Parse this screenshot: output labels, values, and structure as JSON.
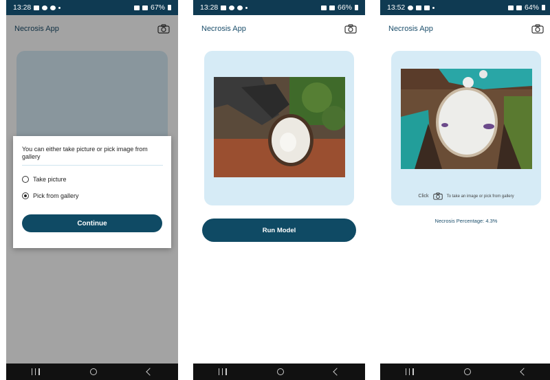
{
  "phones": [
    {
      "status": {
        "time": "13:28",
        "battery": "67%"
      },
      "appbar": {
        "title": "Necrosis App",
        "camera_icon": "camera-icon"
      },
      "dialog": {
        "message": "You can either take picture or pick image from gallery",
        "options": [
          {
            "label": "Take picture",
            "selected": false
          },
          {
            "label": "Pick from gallery",
            "selected": true
          }
        ],
        "continue_label": "Continue"
      }
    },
    {
      "status": {
        "time": "13:28",
        "battery": "66%"
      },
      "appbar": {
        "title": "Necrosis App",
        "camera_icon": "camera-icon"
      },
      "run_label": "Run Model"
    },
    {
      "status": {
        "time": "13:52",
        "battery": "64%"
      },
      "appbar": {
        "title": "Necrosis App",
        "camera_icon": "camera-icon"
      },
      "hint": {
        "click": "Click",
        "text": "To take an image or pick from gallery"
      },
      "result": "Necrosis Percentage: 4.3%"
    }
  ],
  "colors": {
    "primary": "#0f4a64",
    "statusbar": "#0f3a52",
    "card": "#d6ebf6"
  }
}
